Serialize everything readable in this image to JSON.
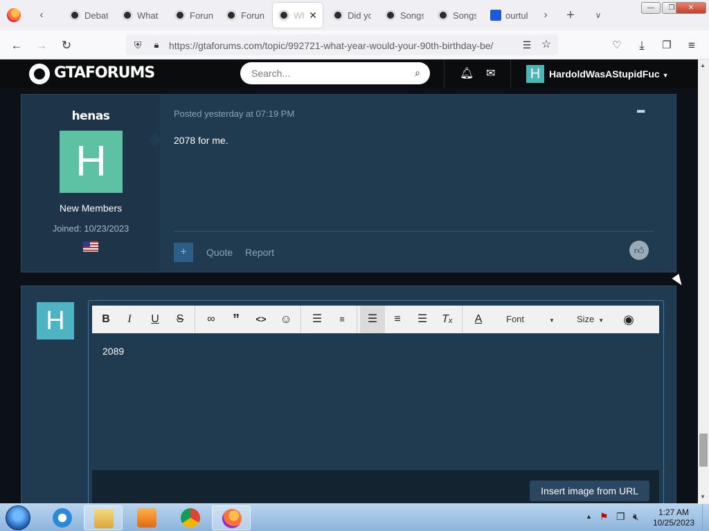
{
  "browser": {
    "tabs": [
      {
        "label": "Debat",
        "favicon": "gtaforums-favicon"
      },
      {
        "label": "What",
        "favicon": "gtaforums-favicon"
      },
      {
        "label": "Forun",
        "favicon": "gtaforums-favicon"
      },
      {
        "label": "Forun",
        "favicon": "gtaforums-favicon"
      },
      {
        "label": "Wh",
        "favicon": "gtaforums-favicon",
        "active": true
      },
      {
        "label": "Did yo",
        "favicon": "gtaforums-favicon"
      },
      {
        "label": "Songs",
        "favicon": "gtaforums-favicon"
      },
      {
        "label": "Songs",
        "favicon": "gtaforums-favicon"
      },
      {
        "label": "ourtul",
        "favicon": "bf-favicon"
      }
    ],
    "url_host": "https://gtaforums.com",
    "url_path": "/topic/992721-what-year-would-your-90th-birthday-be/"
  },
  "site": {
    "logo_text": "GTAFORUMS",
    "search_placeholder": "Search...",
    "user_initial": "H",
    "user_name": "HardoldWasAStupidFuc"
  },
  "post": {
    "author_name": "henas",
    "author_initial": "H",
    "author_group": "New Members",
    "author_joined": "Joined: 10/23/2023",
    "posted": "Posted yesterday at 07:19 PM",
    "body": "2078 for me.",
    "quote_label": "Quote",
    "report_label": "Report",
    "plus_label": "+"
  },
  "reply": {
    "avatar_initial": "H",
    "editor_text": "2089",
    "font_label": "Font",
    "size_label": "Size",
    "insert_image_label": "Insert image from URL"
  },
  "taskbar": {
    "time": "1:27 AM",
    "date": "10/25/2023"
  },
  "colors": {
    "accent": "#4eb4b4",
    "post_bg": "#203a4f",
    "page_bg": "#0b1116"
  }
}
